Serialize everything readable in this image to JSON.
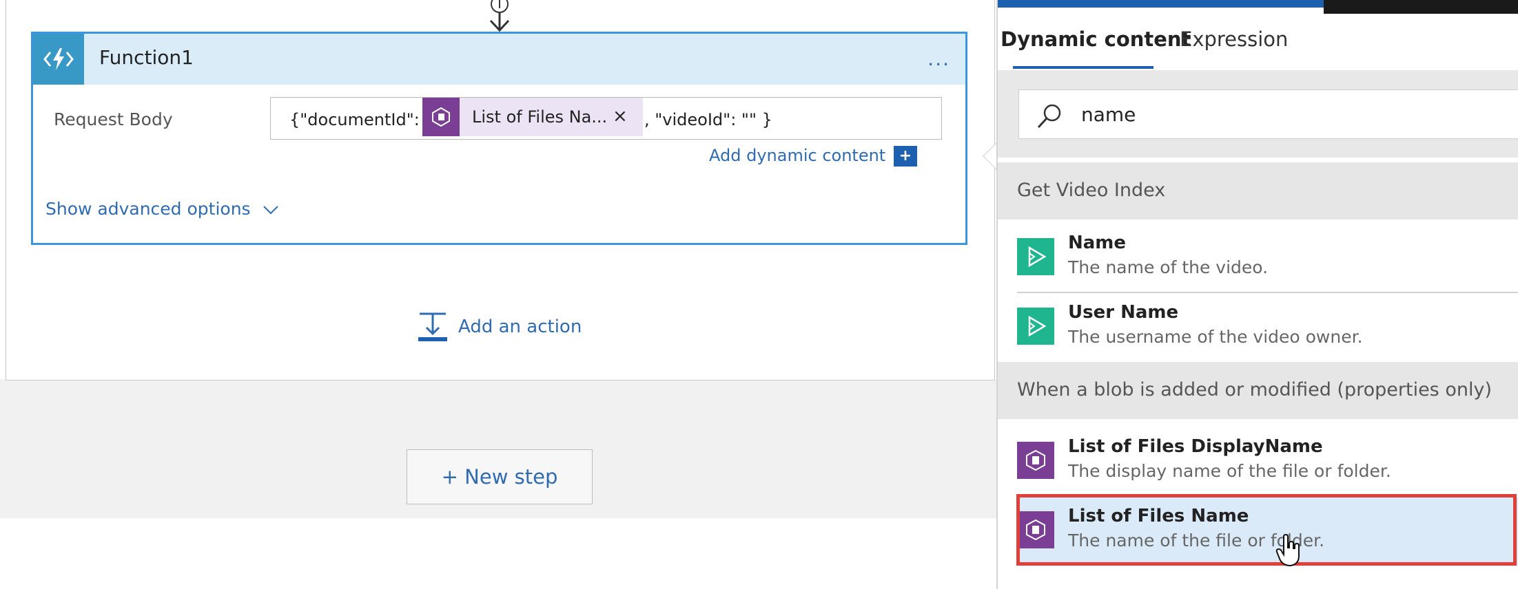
{
  "flow": {
    "action": {
      "title": "Function1",
      "menu": "...",
      "field_label": "Request Body",
      "input_prefix": "{\"documentId\":",
      "token_label": "List of Files Na...",
      "token_close": "×",
      "input_suffix": ", \"videoId\": \"\" }",
      "add_dynamic_label": "Add dynamic content",
      "add_dynamic_icon": "+",
      "show_advanced_label": "Show advanced options"
    },
    "add_action_label": "Add an action",
    "new_step_label": "+ New step"
  },
  "panel": {
    "tabs": [
      "Dynamic content",
      "Expression"
    ],
    "active_tab": "Dynamic content",
    "search": {
      "value": "name"
    },
    "groups": [
      {
        "header": "Get Video Index",
        "items": [
          {
            "title": "Name",
            "description": "The name of the video.",
            "icon": "video-indexer-icon"
          },
          {
            "title": "User Name",
            "description": "The username of the video owner.",
            "icon": "video-indexer-icon"
          }
        ]
      },
      {
        "header": "When a blob is added or modified (properties only)",
        "items": [
          {
            "title": "List of Files DisplayName",
            "description": "The display name of the file or folder.",
            "icon": "blob-storage-icon"
          },
          {
            "title": "List of Files Name",
            "description": "The name of the file or folder.",
            "icon": "blob-storage-icon",
            "selected": true
          }
        ]
      }
    ]
  },
  "colors": {
    "accent_blue": "#1d60b0",
    "card_border": "#3a96dd",
    "function_tile": "#3999c6",
    "blob_purple": "#7a3f94",
    "video_green": "#1fb58f",
    "highlight_red": "#e0403a"
  }
}
